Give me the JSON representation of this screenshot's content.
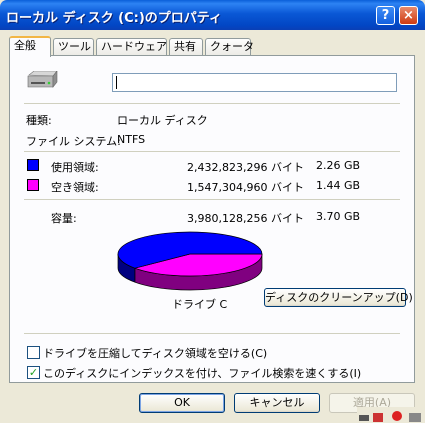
{
  "window": {
    "title": "ローカル ディスク (C:)のプロパティ",
    "help_label": "?",
    "close_label": "×"
  },
  "tabs": [
    "全般",
    "ツール",
    "ハードウェア",
    "共有",
    "クォータ"
  ],
  "drive": {
    "name_value": "",
    "icon": "drive-icon"
  },
  "type": {
    "label": "種類:",
    "value": "ローカル ディスク"
  },
  "filesystem": {
    "label": "ファイル システム:",
    "value": "NTFS"
  },
  "used": {
    "label": "使用領域:",
    "bytes": "2,432,823,296 バイト",
    "size": "2.26 GB",
    "color": "#0000ff"
  },
  "free": {
    "label": "空き領域:",
    "bytes": "1,547,304,960 バイト",
    "size": "1.44 GB",
    "color": "#ff00ff"
  },
  "capacity": {
    "label": "容量:",
    "bytes": "3,980,128,256 バイト",
    "size": "3.70 GB"
  },
  "chart_data": {
    "type": "pie",
    "categories": [
      "使用領域",
      "空き領域"
    ],
    "values": [
      2432823296,
      1547304960
    ],
    "colors": [
      "#0000ff",
      "#ff00ff"
    ],
    "label": "ドライブ C"
  },
  "cleanup_button": "ディスクのクリーンアップ(D)",
  "compress": {
    "label": "ドライブを圧縮してディスク領域を空ける(C)",
    "checked": false
  },
  "index": {
    "label": "このディスクにインデックスを付け、ファイル検索を速くする(I)",
    "checked": true
  },
  "buttons": {
    "ok": "OK",
    "cancel": "キャンセル",
    "apply": "適用(A)"
  }
}
